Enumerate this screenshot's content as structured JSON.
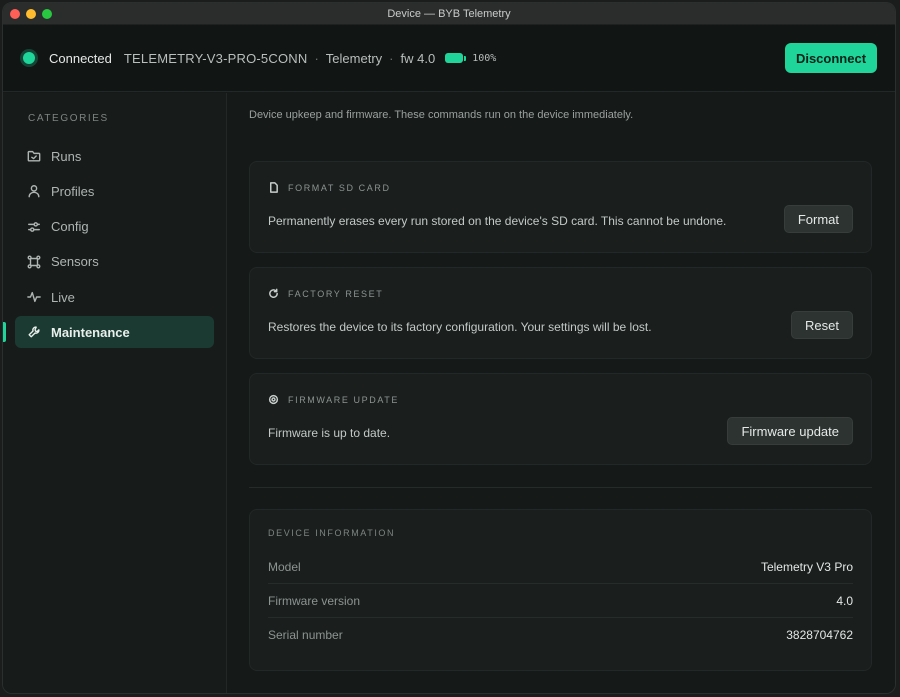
{
  "window": {
    "title": "Device — BYB Telemetry"
  },
  "header": {
    "status": "Connected",
    "device_name": "TELEMETRY-V3-PRO-5CONN",
    "separator": "·",
    "mode": "Telemetry",
    "firmware": "fw 4.0",
    "battery_percent": "100%",
    "battery_level": 1.0,
    "disconnect_label": "Disconnect",
    "accent_color": "#1fd59a"
  },
  "sidebar": {
    "heading": "CATEGORIES",
    "items": [
      {
        "label": "Runs",
        "icon": "folder-icon"
      },
      {
        "label": "Profiles",
        "icon": "user-icon"
      },
      {
        "label": "Config",
        "icon": "sliders-icon"
      },
      {
        "label": "Sensors",
        "icon": "sensors-icon"
      },
      {
        "label": "Live",
        "icon": "activity-icon"
      },
      {
        "label": "Maintenance",
        "icon": "wrench-icon",
        "active": true
      }
    ]
  },
  "content": {
    "intro": "Device upkeep and firmware. These commands run on the device immediately.",
    "cards": [
      {
        "title": "FORMAT SD CARD",
        "icon": "sd-card-icon",
        "description": "Permanently erases every run stored on the device's SD card. This cannot be undone.",
        "button": "Format"
      },
      {
        "title": "FACTORY RESET",
        "icon": "reset-icon",
        "description": "Restores the device to its factory configuration. Your settings will be lost.",
        "button": "Reset"
      },
      {
        "title": "FIRMWARE UPDATE",
        "icon": "chip-icon",
        "description": "Firmware is up to date.",
        "button": "Firmware update"
      }
    ],
    "device_info": {
      "title": "DEVICE INFORMATION",
      "rows": [
        {
          "key": "Model",
          "value": "Telemetry V3 Pro"
        },
        {
          "key": "Firmware version",
          "value": "4.0"
        },
        {
          "key": "Serial number",
          "value": "3828704762"
        }
      ]
    }
  }
}
